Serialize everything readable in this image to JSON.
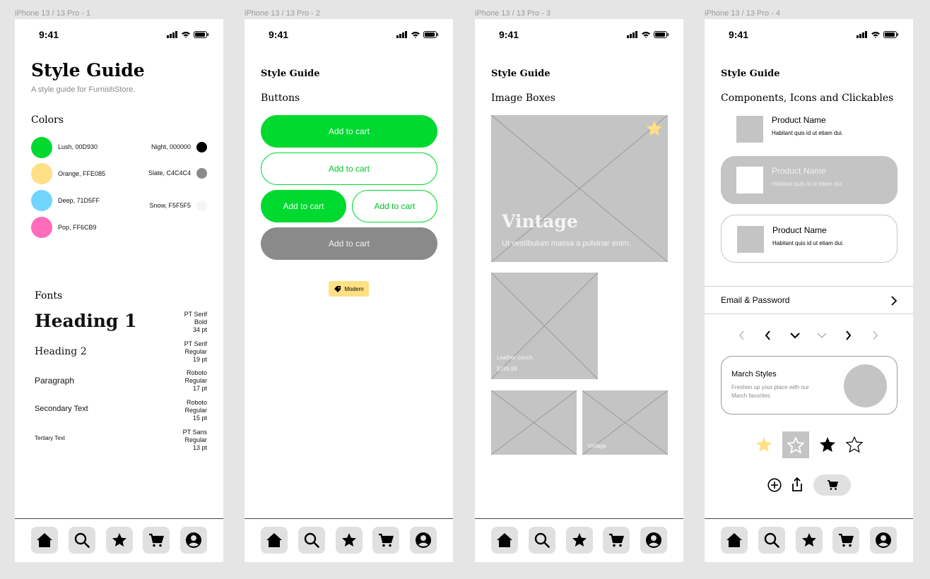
{
  "frames": [
    {
      "label": "iPhone 13 / 13 Pro - 1"
    },
    {
      "label": "iPhone 13 / 13 Pro - 2"
    },
    {
      "label": "iPhone 13 / 13 Pro - 3"
    },
    {
      "label": "iPhone 13 / 13 Pro - 4"
    }
  ],
  "status": {
    "time": "9:41"
  },
  "p1": {
    "title": "Style Guide",
    "subtitle": "A style guide for FurnishStore.",
    "colors_heading": "Colors",
    "colors_left": [
      {
        "label": "Lush, 00D930",
        "hex": "#00D930"
      },
      {
        "label": "Orange, FFE085",
        "hex": "#FFE085"
      },
      {
        "label": "Deep, 71D5FF",
        "hex": "#71D5FF"
      },
      {
        "label": "Pop, FF6CB9",
        "hex": "#FF6CB9"
      }
    ],
    "colors_right": [
      {
        "label": "Night, 000000",
        "hex": "#000000"
      },
      {
        "label": "Slate, C4C4C4",
        "hex": "#8a8a8a"
      },
      {
        "label": "Snow, F5F5F5",
        "hex": "#F5F5F5"
      }
    ],
    "fonts_heading": "Fonts",
    "fonts": [
      {
        "name": "Heading 1",
        "spec1": "PT Serif",
        "spec2": "Bold",
        "spec3": "34 pt"
      },
      {
        "name": "Heading 2",
        "spec1": "PT Serif",
        "spec2": "Regular",
        "spec3": "19 pt"
      },
      {
        "name": "Paragraph",
        "spec1": "Roboto",
        "spec2": "Regular",
        "spec3": "17 pt"
      },
      {
        "name": "Secondary Text",
        "spec1": "Roboto",
        "spec2": "Regular",
        "spec3": "15 pt"
      },
      {
        "name": "Tertiary Text",
        "spec1": "PT Sans",
        "spec2": "Regular",
        "spec3": "13 pt"
      }
    ]
  },
  "p2": {
    "title": "Style Guide",
    "section": "Buttons",
    "btn_label": "Add to cart",
    "tag_label": "Modern"
  },
  "p3": {
    "title": "Style Guide",
    "section": "Image Boxes",
    "hero_title": "Vintage",
    "hero_sub": "Ut vestibulum massa a pulvinar enim.",
    "card_name": "Leather couch",
    "card_price": "$199.99",
    "small_caption": "Vintage"
  },
  "p4": {
    "title": "Style Guide",
    "section": "Components, Icons and Clickables",
    "product_name": "Product Name",
    "product_desc": "Habitant quis id ut etiam dui.",
    "email_row": "Email & Password",
    "promo_title": "March Styles",
    "promo_desc_1": "Freshen up your place with our",
    "promo_desc_2": "March favorites."
  },
  "tabs": [
    "home-icon",
    "search-icon",
    "star-icon",
    "cart-icon",
    "profile-icon"
  ]
}
